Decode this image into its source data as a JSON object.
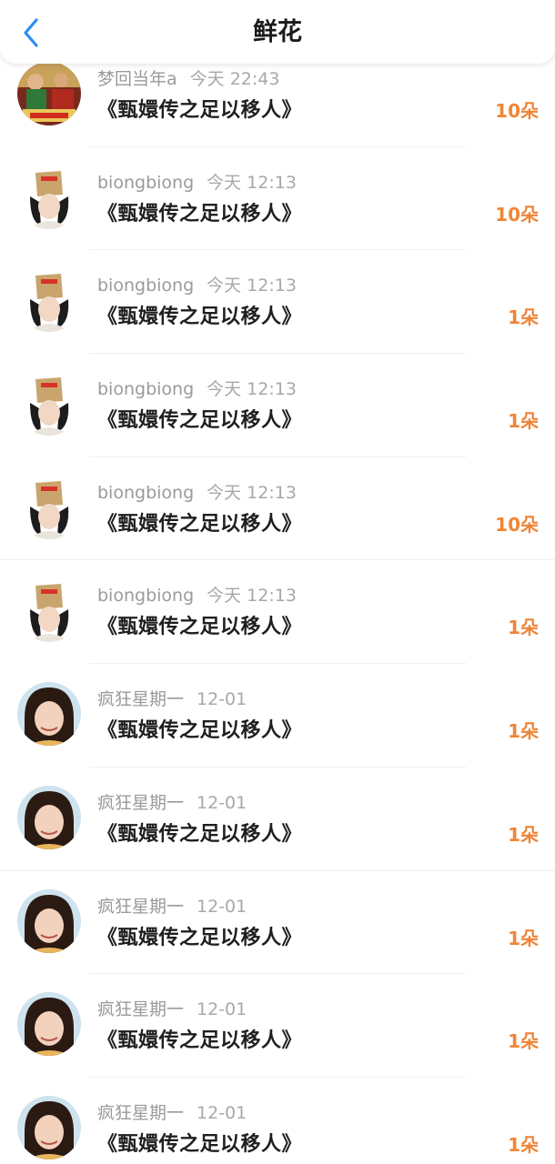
{
  "header": {
    "title": "鲜花",
    "back_icon": "chevron-left-icon",
    "accent_color": "#2d8cf0"
  },
  "colors": {
    "count_color": "#f08435",
    "username_color": "#9a9a9a",
    "title_color": "#1f1f1f"
  },
  "items": [
    {
      "user": "梦回当年a",
      "time": "今天 22:43",
      "title": "《甄嬛传之足以移人》",
      "count": "10朵",
      "avatar": "movie-poster-avatar"
    },
    {
      "user": "biongbiong",
      "time": "今天 12:13",
      "title": "《甄嬛传之足以移人》",
      "count": "10朵",
      "avatar": "paper-bag-hat-girl-avatar"
    },
    {
      "user": "biongbiong",
      "time": "今天 12:13",
      "title": "《甄嬛传之足以移人》",
      "count": "1朵",
      "avatar": "paper-bag-hat-girl-avatar"
    },
    {
      "user": "biongbiong",
      "time": "今天 12:13",
      "title": "《甄嬛传之足以移人》",
      "count": "1朵",
      "avatar": "paper-bag-hat-girl-avatar"
    },
    {
      "user": "biongbiong",
      "time": "今天 12:13",
      "title": "《甄嬛传之足以移人》",
      "count": "10朵",
      "avatar": "paper-bag-hat-girl-avatar"
    },
    {
      "user": "biongbiong",
      "time": "今天 12:13",
      "title": "《甄嬛传之足以移人》",
      "count": "1朵",
      "avatar": "paper-bag-hat-girl-avatar"
    },
    {
      "user": "疯狂星期一",
      "time": "12-01",
      "title": "《甄嬛传之足以移人》",
      "count": "1朵",
      "avatar": "smiling-woman-avatar"
    },
    {
      "user": "疯狂星期一",
      "time": "12-01",
      "title": "《甄嬛传之足以移人》",
      "count": "1朵",
      "avatar": "smiling-woman-avatar"
    },
    {
      "user": "疯狂星期一",
      "time": "12-01",
      "title": "《甄嬛传之足以移人》",
      "count": "1朵",
      "avatar": "smiling-woman-avatar"
    },
    {
      "user": "疯狂星期一",
      "time": "12-01",
      "title": "《甄嬛传之足以移人》",
      "count": "1朵",
      "avatar": "smiling-woman-avatar"
    },
    {
      "user": "疯狂星期一",
      "time": "12-01",
      "title": "《甄嬛传之足以移人》",
      "count": "1朵",
      "avatar": "smiling-woman-avatar"
    }
  ]
}
